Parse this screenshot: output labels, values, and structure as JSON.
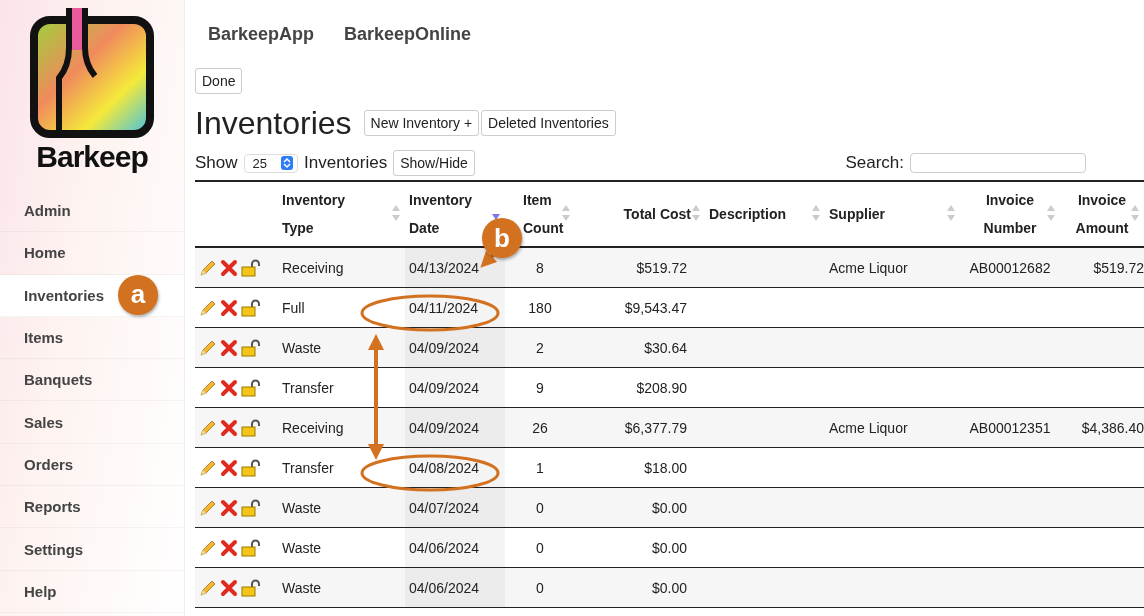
{
  "logo": {
    "name": "Barkeep"
  },
  "sidebar": {
    "items": [
      {
        "label": "Admin",
        "selected": false
      },
      {
        "label": "Home",
        "selected": false
      },
      {
        "label": "Inventories",
        "selected": true
      },
      {
        "label": "Items",
        "selected": false
      },
      {
        "label": "Banquets",
        "selected": false
      },
      {
        "label": "Sales",
        "selected": false
      },
      {
        "label": "Orders",
        "selected": false
      },
      {
        "label": "Reports",
        "selected": false
      },
      {
        "label": "Settings",
        "selected": false
      },
      {
        "label": "Help",
        "selected": false
      }
    ]
  },
  "top_nav": [
    "BarkeepApp",
    "BarkeepOnline"
  ],
  "done_button": "Done",
  "title": "Inventories",
  "header_buttons": [
    "New Inventory +",
    "Deleted Inventories"
  ],
  "show": {
    "label": "Show",
    "value": "25",
    "suffix": "Inventories",
    "toggle": "Show/Hide"
  },
  "search": {
    "label": "Search:"
  },
  "table": {
    "columns": [
      {
        "label": "Inventory Type",
        "sorted": false
      },
      {
        "label": "Inventory Date",
        "sorted": true
      },
      {
        "label": "Item Count",
        "sorted": false
      },
      {
        "label": "Total Cost",
        "sorted": false
      },
      {
        "label": "Description",
        "sorted": false
      },
      {
        "label": "Supplier",
        "sorted": false
      },
      {
        "label": "Invoice Number",
        "sorted": false
      },
      {
        "label": "Invoice Amount",
        "sorted": false
      }
    ],
    "rows": [
      {
        "type": "Receiving",
        "date": "04/13/2024",
        "count": "8",
        "cost": "$519.72",
        "supplier": "Acme Liquor",
        "invoice_number": "AB00012682",
        "invoice_amount": "$519.72",
        "circled": false
      },
      {
        "type": "Full",
        "date": "04/11/2024",
        "count": "180",
        "cost": "$9,543.47",
        "circled": true
      },
      {
        "type": "Waste",
        "date": "04/09/2024",
        "count": "2",
        "cost": "$30.64",
        "circled": false
      },
      {
        "type": "Transfer",
        "date": "04/09/2024",
        "count": "9",
        "cost": "$208.90",
        "circled": false
      },
      {
        "type": "Receiving",
        "date": "04/09/2024",
        "count": "26",
        "cost": "$6,377.79",
        "supplier": "Acme Liquor",
        "invoice_number": "AB00012351",
        "invoice_amount": "$4,386.40",
        "circled": false
      },
      {
        "type": "Transfer",
        "date": "04/08/2024",
        "count": "1",
        "cost": "$18.00",
        "circled": true
      },
      {
        "type": "Waste",
        "date": "04/07/2024",
        "count": "0",
        "cost": "$0.00",
        "circled": false
      },
      {
        "type": "Waste",
        "date": "04/06/2024",
        "count": "0",
        "cost": "$0.00",
        "circled": false
      },
      {
        "type": "Waste",
        "date": "04/06/2024",
        "count": "0",
        "cost": "$0.00",
        "circled": false
      }
    ]
  },
  "callouts": [
    {
      "label": "a"
    },
    {
      "label": "b"
    }
  ]
}
